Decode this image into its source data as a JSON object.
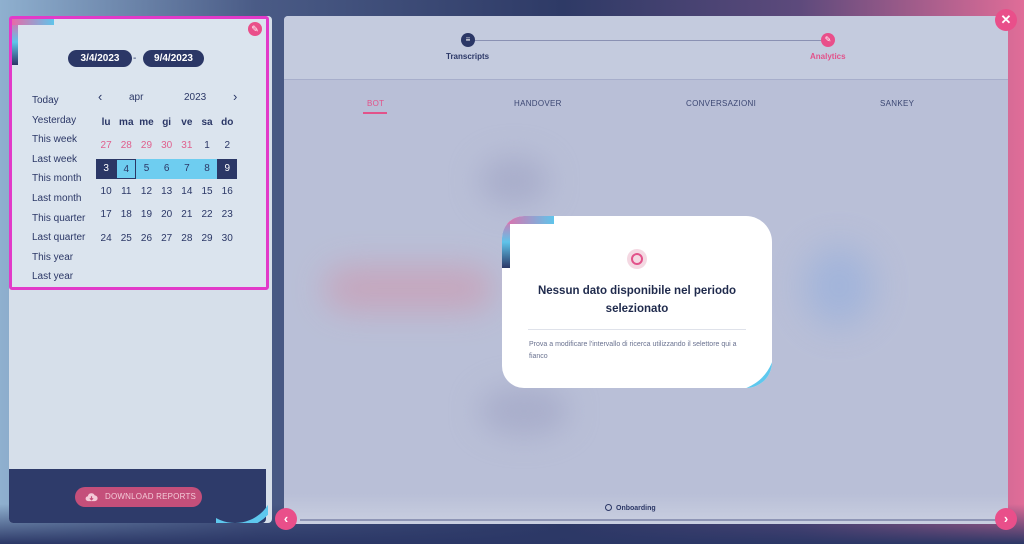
{
  "date_range": {
    "start": "3/4/2023",
    "separator": "-",
    "end": "9/4/2023"
  },
  "quick_ranges": [
    "Today",
    "Yesterday",
    "This week",
    "Last week",
    "This month",
    "Last month",
    "This quarter",
    "Last quarter",
    "This year",
    "Last year"
  ],
  "calendar": {
    "month": "apr",
    "year": "2023",
    "weekdays": [
      "lu",
      "ma",
      "me",
      "gi",
      "ve",
      "sa",
      "do"
    ],
    "weeks": [
      [
        "27",
        "28",
        "29",
        "30",
        "31",
        "1",
        "2"
      ],
      [
        "3",
        "4",
        "5",
        "6",
        "7",
        "8",
        "9"
      ],
      [
        "10",
        "11",
        "12",
        "13",
        "14",
        "15",
        "16"
      ],
      [
        "17",
        "18",
        "19",
        "20",
        "21",
        "22",
        "23"
      ],
      [
        "24",
        "25",
        "26",
        "27",
        "28",
        "29",
        "30"
      ]
    ],
    "other_month_count_first_week": 5,
    "range_start": "3",
    "range_end": "9",
    "today": "4"
  },
  "download_button": "DOWNLOAD REPORTS",
  "stepper": {
    "step1": "Transcripts",
    "step2": "Analytics"
  },
  "tabs": [
    "BOT",
    "HANDOVER",
    "CONVERSAZIONI",
    "SANKEY"
  ],
  "active_tab": "BOT",
  "modal": {
    "title": "Nessun dato disponibile nel periodo selezionato",
    "text": "Prova a modificare l'intervallo di ricerca utilizzando il selettore qui a fianco"
  },
  "onboarding_link": "Onboarding",
  "colors": {
    "accent": "#e94f8a",
    "navy": "#2b3766",
    "cyan": "#5ec8ee"
  }
}
